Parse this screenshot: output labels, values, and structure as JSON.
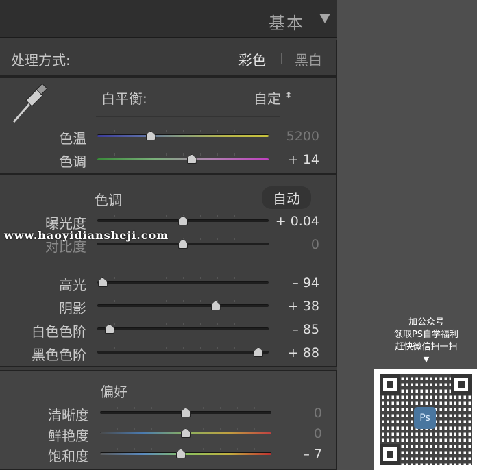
{
  "header": {
    "title": "基本"
  },
  "treatment": {
    "label": "处理方式:",
    "color": "彩色",
    "bw": "黑白"
  },
  "wb": {
    "label": "白平衡:",
    "value": "自定",
    "temp": {
      "label": "色温",
      "value": "5200",
      "level": 0.31
    },
    "tint": {
      "label": "色调",
      "value": "+ 14",
      "level": 0.55
    }
  },
  "tone": {
    "heading": "色调",
    "auto": "自动",
    "exposure": {
      "label": "曝光度",
      "value": "+ 0.04",
      "level": 0.5
    },
    "contrast": {
      "label": "对比度",
      "value": "0",
      "level": 0.5
    },
    "highlights": {
      "label": "高光",
      "value": "– 94",
      "level": 0.03
    },
    "shadows": {
      "label": "阴影",
      "value": "+ 38",
      "level": 0.69
    },
    "whites": {
      "label": "白色色阶",
      "value": "– 85",
      "level": 0.07
    },
    "blacks": {
      "label": "黑色色阶",
      "value": "+ 88",
      "level": 0.94
    }
  },
  "presence": {
    "heading": "偏好",
    "clarity": {
      "label": "清晰度",
      "value": "0",
      "level": 0.5
    },
    "vibrance": {
      "label": "鲜艳度",
      "value": "0",
      "level": 0.5
    },
    "saturation": {
      "label": "饱和度",
      "value": "– 7",
      "level": 0.47
    }
  },
  "watermark": "www.haoyidiansheji.com",
  "promo": {
    "line1": "加公众号",
    "line2": "领取PS自学福利",
    "line3": "赶快微信扫一扫",
    "ps": "Ps"
  },
  "icons": {
    "eyedropper": "eyedropper-icon",
    "collapse": "triangle-down-icon",
    "updown": "updown-icon",
    "arrow": "arrow-down-icon"
  }
}
